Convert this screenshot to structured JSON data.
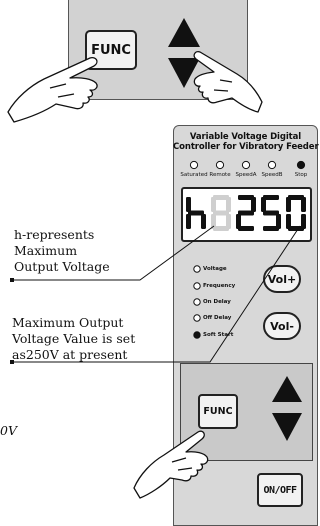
{
  "top_panel": {
    "func_label": "FUNC",
    "arrow_icons": [
      "up-arrow-icon",
      "down-arrow-icon"
    ],
    "hand_icon": "pointing-hand-icon"
  },
  "controller": {
    "title_line1": "Variable Voltage Digital",
    "title_line2": "Controller for Vibratory Feeder",
    "status_indicators": [
      {
        "label": "Saturated",
        "lit": false
      },
      {
        "label": "Remote",
        "lit": false
      },
      {
        "label": "SpeedA",
        "lit": false
      },
      {
        "label": "SpeedB",
        "lit": false
      },
      {
        "label": "Stop",
        "lit": true
      }
    ],
    "display": {
      "chars": [
        "h",
        "8",
        "2",
        "5",
        "0"
      ],
      "dim_positions": [
        1
      ]
    },
    "parameters": [
      {
        "label": "Voltage",
        "lit": false
      },
      {
        "label": "Frequency",
        "lit": false
      },
      {
        "label": "On Delay",
        "lit": false
      },
      {
        "label": "Off Delay",
        "lit": false
      },
      {
        "label": "Soft Start",
        "lit": true
      }
    ],
    "vol_plus_label": "Vol+",
    "vol_minus_label": "Vol-",
    "func_label": "FUNC",
    "onoff_label": "ON/OFF"
  },
  "annotations": {
    "note_h": [
      "h-represents",
      "Maximum",
      "Output Voltage"
    ],
    "note_value": [
      "Maximum Output",
      "Voltage Value is set",
      "as250V at present"
    ],
    "cut_text": "0V"
  },
  "colors": {
    "panel": "#d8d8d8",
    "panel_dark": "#c9c9c9",
    "lit": "#111111",
    "segment_dim": "#cfcfcf"
  }
}
